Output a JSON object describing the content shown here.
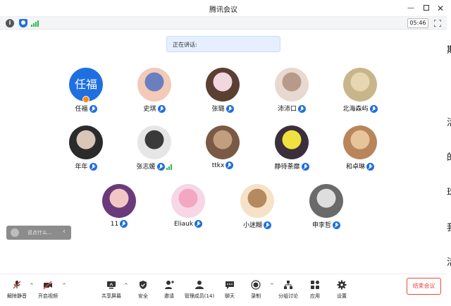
{
  "window": {
    "title": "腾讯会议",
    "controls": {
      "min": "—",
      "close": "✕"
    }
  },
  "status": {
    "timer": "05:46",
    "info_glyph": "i"
  },
  "speaking_label": "正在讲话:",
  "participants": [
    {
      "name": "任福",
      "avatar_text": "任福",
      "host": true,
      "mic": "on"
    },
    {
      "name": "史琪",
      "mic": "on"
    },
    {
      "name": "张璐",
      "mic": "on"
    },
    {
      "name": "沛沛口",
      "mic": "on"
    },
    {
      "name": "北海森屿",
      "mic": "on"
    },
    {
      "name": "年年",
      "mic": "on"
    },
    {
      "name": "张志媛",
      "mic": "on",
      "speaking": true
    },
    {
      "name": "ttkx",
      "mic": "on"
    },
    {
      "name": "静待荼靡",
      "mic": "on"
    },
    {
      "name": "和卓琳",
      "mic": "on"
    },
    {
      "name": "11",
      "mic": "on"
    },
    {
      "name": "Eliauk",
      "mic": "on"
    },
    {
      "name": "小迷糊",
      "mic": "on"
    },
    {
      "name": "申李哲",
      "mic": "on"
    }
  ],
  "chat": {
    "placeholder": "说点什么...",
    "collapse_glyph": "‹"
  },
  "toolbar": {
    "unmute": "解除静音",
    "video": "开启视频",
    "share": "共享屏幕",
    "security": "安全",
    "invite": "邀请",
    "members": "管理成员(14)",
    "chat": "聊天",
    "record": "录制",
    "breakout": "分组讨论",
    "apps": "应用",
    "settings": "设置",
    "end": "结束会议",
    "caret": "^"
  },
  "edge_text": [
    "期",
    "",
    "活",
    "的",
    "球",
    "我",
    "活"
  ],
  "colors": {
    "accent": "#1f6fe0",
    "end": "#e9473c",
    "signal": "#2db84d",
    "host_badge": "#ff8a00"
  }
}
